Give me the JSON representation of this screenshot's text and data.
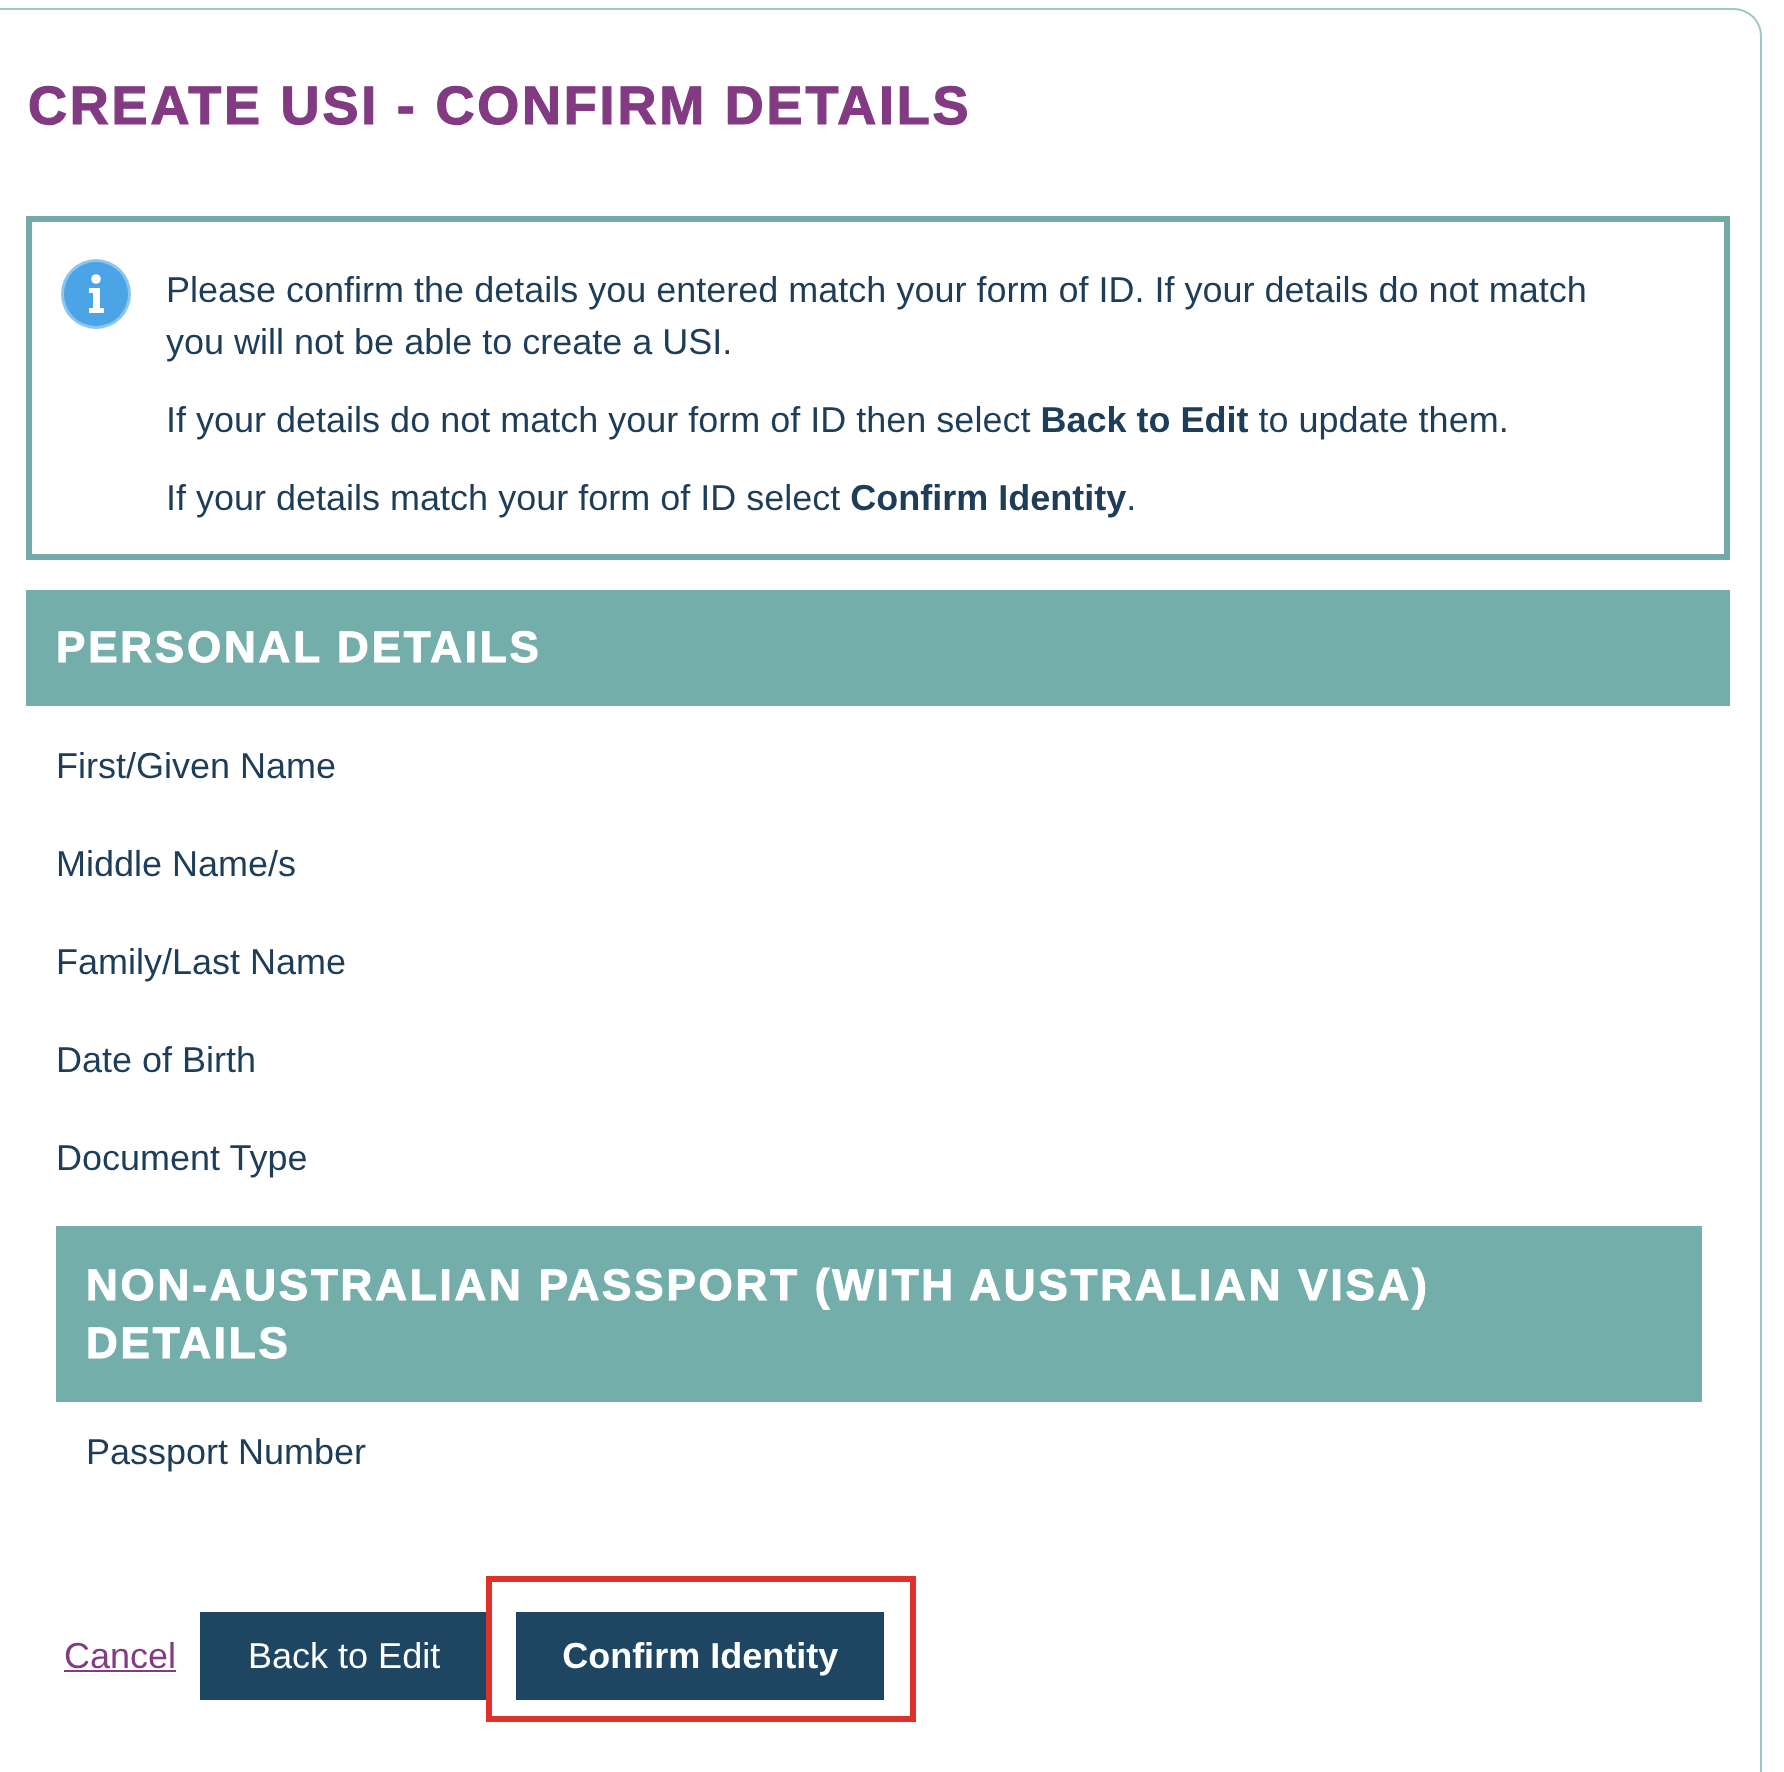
{
  "title": "CREATE USI - CONFIRM DETAILS",
  "notice": {
    "paragraphs": [
      "Please confirm the details you entered match your form of ID. If your details do not match you will not be able to create a USI.",
      "If your details do not match your form of ID then select **Back to Edit** to update them.",
      "If your details match your form of ID select **Confirm Identity**."
    ]
  },
  "sections": [
    {
      "heading": "PERSONAL DETAILS",
      "fields": [
        "First/Given Name",
        "Middle Name/s",
        "Family/Last Name",
        "Date of Birth",
        "Document Type"
      ],
      "subsections": [
        {
          "heading": "NON-AUSTRALIAN PASSPORT (WITH AUSTRALIAN VISA) DETAILS",
          "fields": [
            "Passport Number"
          ]
        }
      ]
    }
  ],
  "actions": [
    {
      "kind": "link",
      "label": "Cancel",
      "highlighted": false
    },
    {
      "kind": "button",
      "label": "Back to Edit",
      "highlighted": false
    },
    {
      "kind": "primary",
      "label": "Confirm Identity",
      "highlighted": true
    }
  ]
}
